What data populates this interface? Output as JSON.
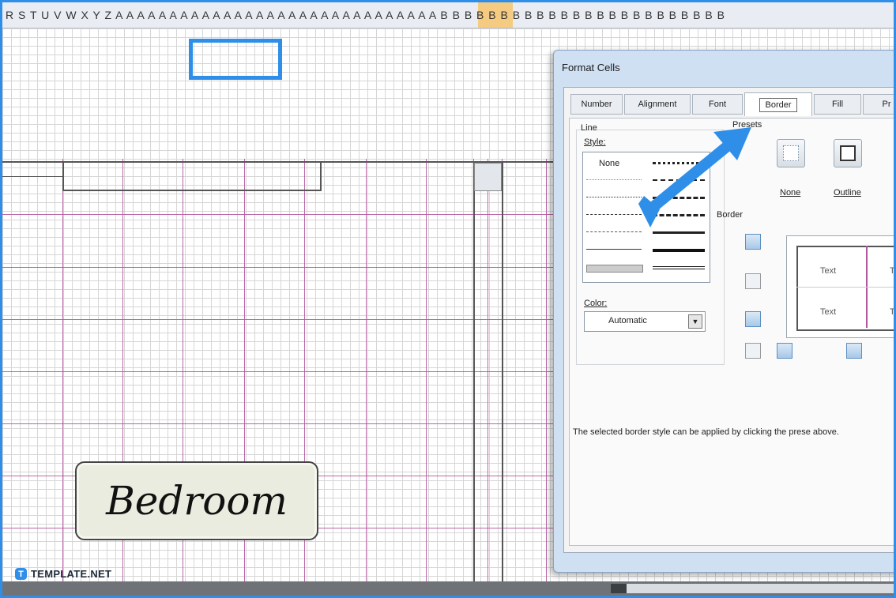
{
  "sheet": {
    "column_letters": "R S T U V W X Y Z A A A A A A A A A A A A A A A A A A A A A A A A A A A A A A B B B B B B B B B B B B B B B B B B B B B B B B",
    "label_text": "Bedroom"
  },
  "branding": {
    "logo_letter": "T",
    "name": "TEMPLATE.NET"
  },
  "dialog": {
    "title": "Format Cells",
    "tabs": [
      "Number",
      "Alignment",
      "Font",
      "Border",
      "Fill",
      "Pr"
    ],
    "active_tab": "Border",
    "line_group_label": "Line",
    "style_label": "Style:",
    "style_none": "None",
    "color_label": "Color:",
    "color_value": "Automatic",
    "presets_label": "Presets",
    "preset_none": "None",
    "preset_outline": "Outline",
    "border_label": "Border",
    "preview_texts": [
      "Text",
      "Te",
      "Text",
      "Te"
    ],
    "hint_text": "The selected border style can be applied by clicking the prese above."
  },
  "colors": {
    "accent": "#2f8fe8",
    "gridline_purple": "#b3579f",
    "column_highlight": "#f7c46d"
  }
}
